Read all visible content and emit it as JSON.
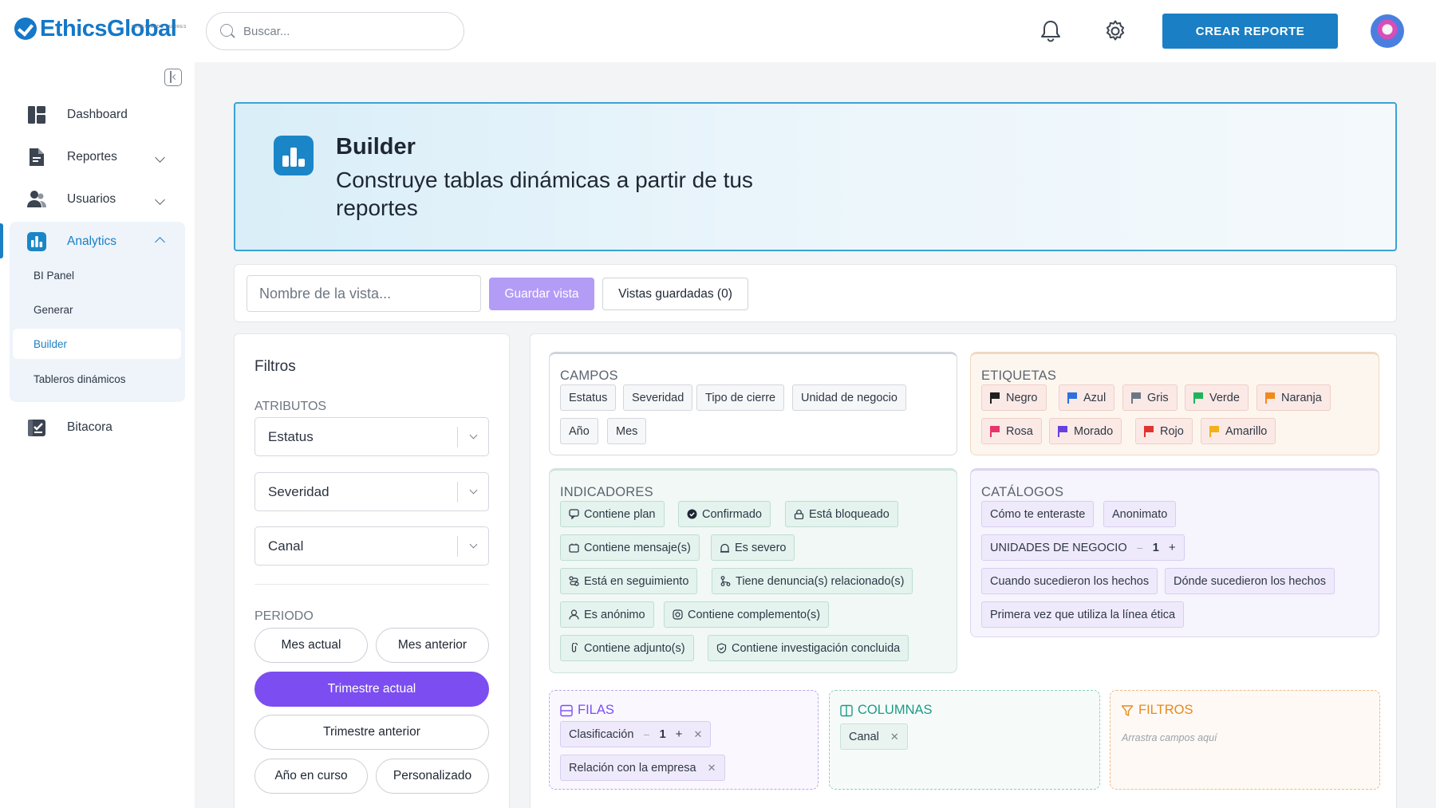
{
  "header": {
    "logo_text": "EthicsGlobal",
    "logo_tagline": "FOMENTANDO VALORES",
    "search_placeholder": "Buscar...",
    "create_button": "CREAR REPORTE"
  },
  "sidebar": {
    "items": [
      {
        "label": "Dashboard",
        "icon": "dashboard-icon"
      },
      {
        "label": "Reportes",
        "icon": "document-icon"
      },
      {
        "label": "Usuarios",
        "icon": "users-icon"
      },
      {
        "label": "Analytics",
        "icon": "analytics-icon"
      },
      {
        "label": "Bitacora",
        "icon": "logbook-icon"
      }
    ],
    "analytics_sub": [
      "BI Panel",
      "Generar",
      "Builder",
      "Tableros dinámicos"
    ]
  },
  "banner": {
    "title": "Builder",
    "subtitle": "Construye tablas dinámicas a partir de tus reportes"
  },
  "viewbar": {
    "name_placeholder": "Nombre de la vista...",
    "save_label": "Guardar vista",
    "saved_label": "Vistas guardadas (0)"
  },
  "filters": {
    "title": "Filtros",
    "attributes_label": "ATRIBUTOS",
    "selects": [
      "Estatus",
      "Severidad",
      "Canal"
    ],
    "period_label": "PERIODO",
    "periods": [
      "Mes actual",
      "Mes anterior",
      "Trimestre actual",
      "Trimestre anterior",
      "Año en curso",
      "Personalizado"
    ],
    "active_period": "Trimestre actual"
  },
  "campos": {
    "title": "CAMPOS",
    "chips": [
      "Estatus",
      "Severidad",
      "Tipo de cierre",
      "Unidad de negocio",
      "Año",
      "Mes"
    ]
  },
  "etiquetas": {
    "title": "ETIQUETAS",
    "chips": [
      {
        "label": "Negro",
        "color": "#1f1f1f"
      },
      {
        "label": "Azul",
        "color": "#2f6fe0"
      },
      {
        "label": "Gris",
        "color": "#6b7785"
      },
      {
        "label": "Verde",
        "color": "#22b35a"
      },
      {
        "label": "Naranja",
        "color": "#f08a1c"
      },
      {
        "label": "Rosa",
        "color": "#e8346a"
      },
      {
        "label": "Morado",
        "color": "#6a3fe0"
      },
      {
        "label": "Rojo",
        "color": "#e0342f"
      },
      {
        "label": "Amarillo",
        "color": "#f2b01a"
      }
    ]
  },
  "indicadores": {
    "title": "INDICADORES",
    "chips": [
      "Contiene plan",
      "Confirmado",
      "Está bloqueado",
      "Contiene mensaje(s)",
      "Es severo",
      "Está en seguimiento",
      "Tiene denuncia(s) relacionado(s)",
      "Es anónimo",
      "Contiene complemento(s)",
      "Contiene adjunto(s)",
      "Contiene investigación concluida"
    ]
  },
  "catalogos": {
    "title": "CATÁLOGOS",
    "chips": [
      "Cómo te enteraste",
      "Anonimato",
      "UNIDADES DE NEGOCIO",
      "Cuando sucedieron los hechos",
      "Dónde sucedieron los hechos",
      "Primera vez que utiliza la línea ética"
    ],
    "unidades_level": "1"
  },
  "filas": {
    "title": "FILAS",
    "chips": [
      "Clasificación",
      "Relación con la empresa"
    ],
    "clasificacion_level": "1"
  },
  "columnas": {
    "title": "COLUMNAS",
    "chips": [
      "Canal"
    ]
  },
  "dz_filtros": {
    "title": "FILTROS",
    "hint": "Arrastra campos aquí"
  },
  "colors": {
    "accent": "#1a7fc4",
    "purple": "#7c4df0",
    "indicadores_border": "#1d9a8a",
    "etiquetas_border": "#e58a1f",
    "catalogos_border": "#7c4df0"
  }
}
